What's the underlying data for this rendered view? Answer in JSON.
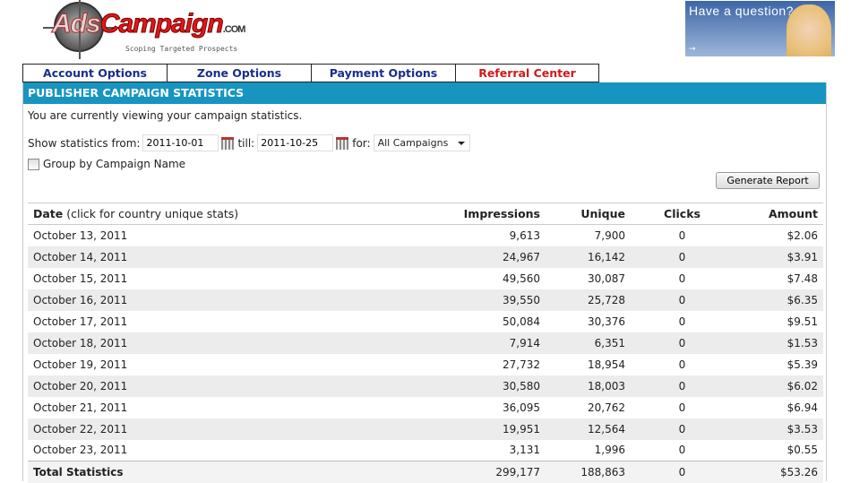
{
  "logo": {
    "text": "AdsCampaign.com",
    "tagline": "Scoping Targeted Prospects"
  },
  "help_banner": {
    "text": "Have a question?"
  },
  "nav": [
    "Account Options",
    "Zone Options",
    "Payment Options",
    "Referral Center"
  ],
  "panel": {
    "title": "PUBLISHER CAMPAIGN STATISTICS",
    "intro": "You are currently viewing your campaign statistics."
  },
  "filters": {
    "from_label": "Show statistics from:",
    "from_value": "2011-10-01",
    "till_label": "till:",
    "till_value": "2011-10-25",
    "for_label": "for:",
    "campaign": "All Campaigns",
    "group_label": "Group by Campaign Name",
    "generate": "Generate Report"
  },
  "table": {
    "headers": {
      "date": "Date",
      "date_hint": " (click for country unique stats)",
      "impressions": "Impressions",
      "unique": "Unique",
      "clicks": "Clicks",
      "amount": "Amount"
    },
    "rows": [
      [
        "October 13, 2011",
        "9,613",
        "7,900",
        "0",
        "$2.06"
      ],
      [
        "October 14, 2011",
        "24,967",
        "16,142",
        "0",
        "$3.91"
      ],
      [
        "October 15, 2011",
        "49,560",
        "30,087",
        "0",
        "$7.48"
      ],
      [
        "October 16, 2011",
        "39,550",
        "25,728",
        "0",
        "$6.35"
      ],
      [
        "October 17, 2011",
        "50,084",
        "30,376",
        "0",
        "$9.51"
      ],
      [
        "October 18, 2011",
        "7,914",
        "6,351",
        "0",
        "$1.53"
      ],
      [
        "October 19, 2011",
        "27,732",
        "18,954",
        "0",
        "$5.39"
      ],
      [
        "October 20, 2011",
        "30,580",
        "18,003",
        "0",
        "$6.02"
      ],
      [
        "October 21, 2011",
        "36,095",
        "20,762",
        "0",
        "$6.94"
      ],
      [
        "October 22, 2011",
        "19,951",
        "12,564",
        "0",
        "$3.53"
      ],
      [
        "October 23, 2011",
        "3,131",
        "1,996",
        "0",
        "$0.55"
      ]
    ],
    "total": [
      "Total Statistics",
      "299,177",
      "188,863",
      "0",
      "$53.26"
    ]
  }
}
